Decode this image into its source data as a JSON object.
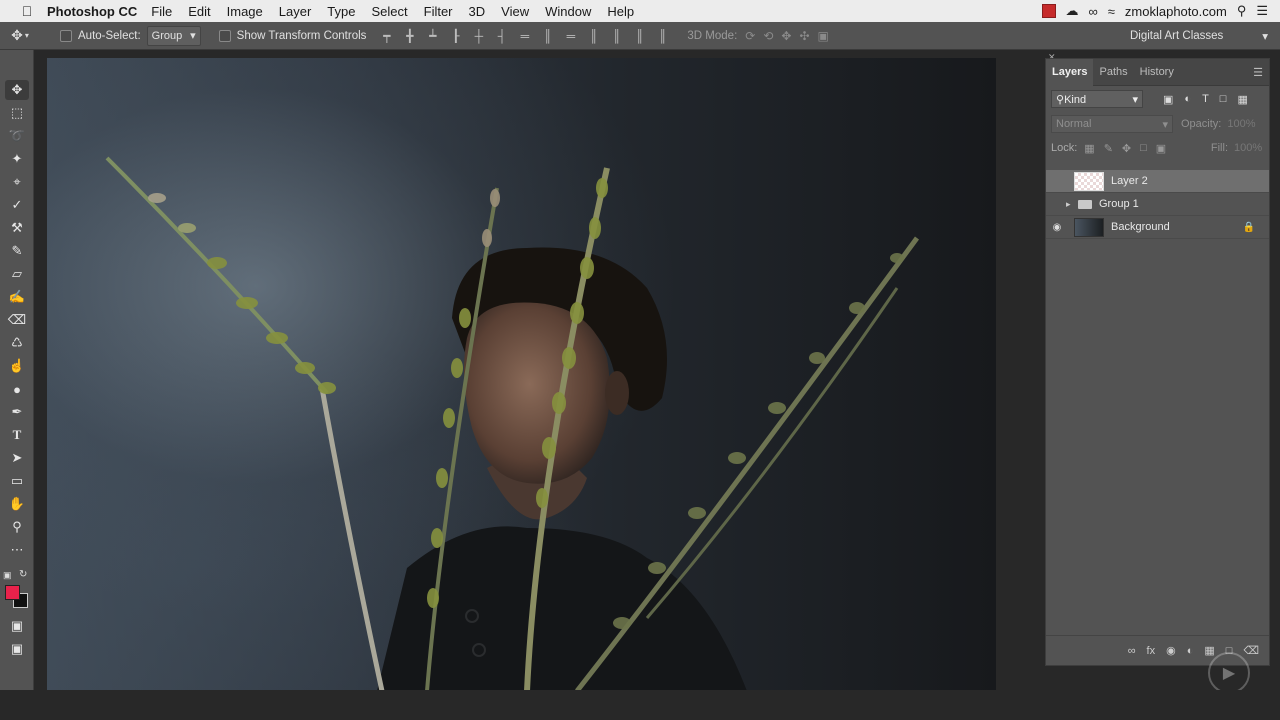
{
  "menubar": {
    "apple_icon": "apple-icon",
    "app_name": "Photoshop CC",
    "items": [
      "File",
      "Edit",
      "Image",
      "Layer",
      "Type",
      "Select",
      "Filter",
      "3D",
      "View",
      "Window",
      "Help"
    ],
    "account": "zmoklaphoto.com",
    "status_icons": [
      "red-status-icon",
      "cloud-icon",
      "creative-cloud-icon",
      "wifi-icon",
      "search-icon",
      "list-icon"
    ]
  },
  "options": {
    "auto_select_label": "Auto-Select:",
    "auto_select_value": "Group",
    "show_transform_label": "Show Transform Controls",
    "mode3d_label": "3D Mode:",
    "workspace": "Digital Art Classes"
  },
  "toolbar": {
    "tools": [
      "move",
      "marquee",
      "lasso",
      "quick-select",
      "crop",
      "eyedropper",
      "healing",
      "brush",
      "stamp",
      "history-brush",
      "eraser",
      "paint-bucket",
      "dodge",
      "smudge",
      "pen",
      "type",
      "path-select",
      "rectangle",
      "hand",
      "zoom",
      "more"
    ],
    "foreground_color": "#e8224b",
    "background_color": "#111111"
  },
  "layers_panel": {
    "tabs": [
      "Layers",
      "Paths",
      "History"
    ],
    "filter_label": "Kind",
    "blend_mode": "Normal",
    "opacity_label": "Opacity:",
    "opacity_value": "100%",
    "lock_label": "Lock:",
    "fill_label": "Fill:",
    "fill_value": "100%",
    "layers": [
      {
        "name": "Layer 2",
        "visible": false,
        "selected": true
      },
      {
        "name": "Group 1",
        "visible": false,
        "selected": false
      },
      {
        "name": "Background",
        "visible": true,
        "selected": false
      }
    ]
  },
  "colors": {
    "ui_panel": "#535353",
    "canvas_bg": "#282828",
    "accent_fg": "#e8224b"
  }
}
